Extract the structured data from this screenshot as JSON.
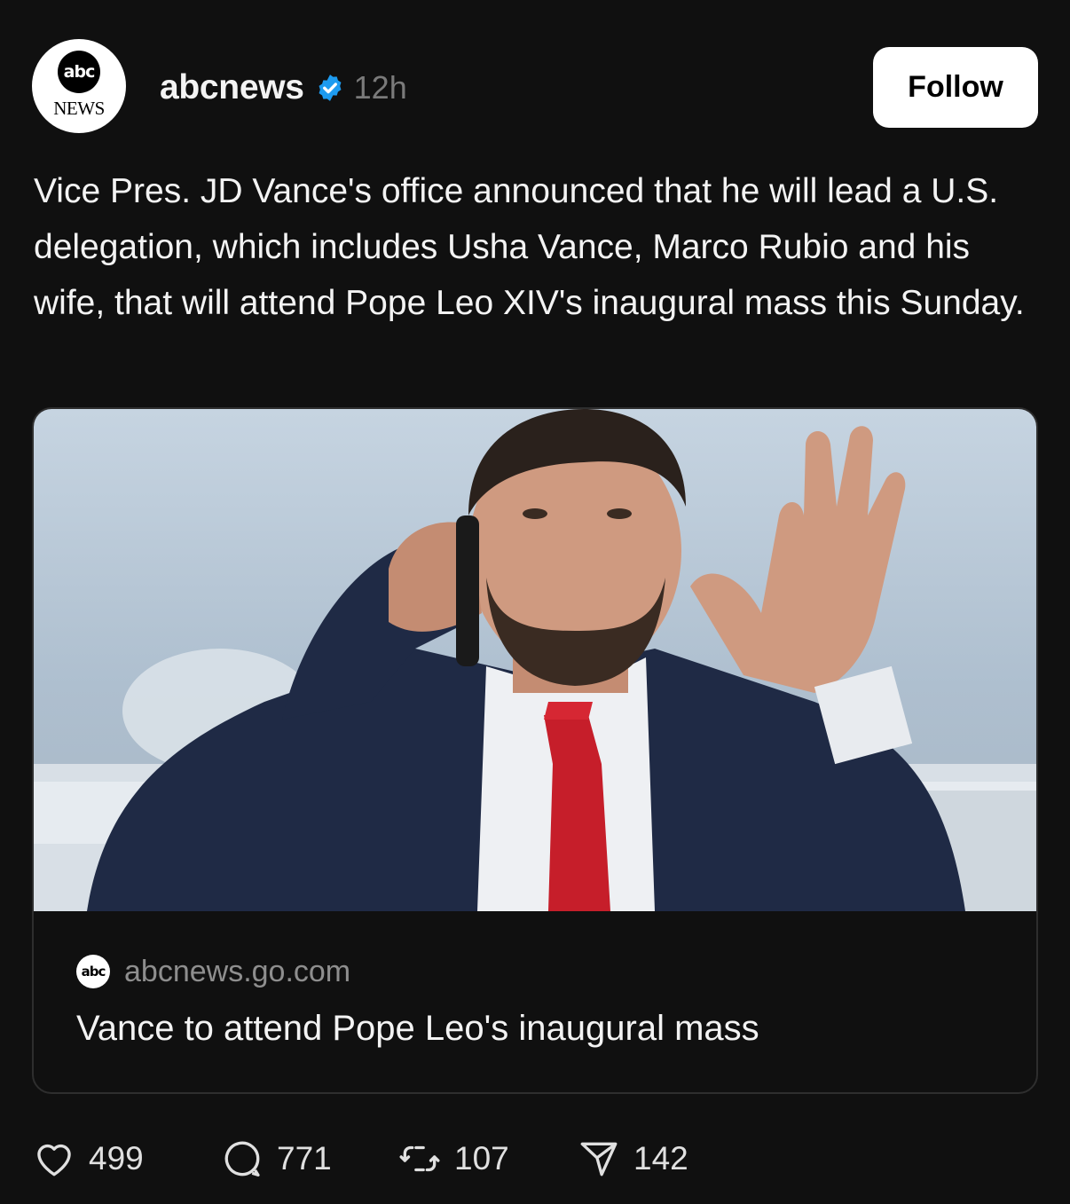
{
  "post": {
    "author": {
      "username": "abcnews",
      "verified": true,
      "timestamp": "12h",
      "avatar": {
        "logo_text": "abc",
        "wordmark": "NEWS"
      }
    },
    "follow_label": "Follow",
    "text": "Vice Pres. JD Vance's office announced that he will lead a U.S. delegation, which includes Usha Vance, Marco Rubio and his wife, that will attend Pope Leo XIV's inaugural mass this Sunday.",
    "link_card": {
      "source_icon_text": "abc",
      "domain": "abcnews.go.com",
      "title": "Vance to attend Pope Leo's inaugural mass"
    },
    "actions": {
      "likes": "499",
      "replies": "771",
      "reposts": "107",
      "shares": "142"
    }
  },
  "colors": {
    "background": "#101010",
    "text": "#f3f3f3",
    "muted": "#7a7a7a",
    "verified": "#1d9bf0",
    "follow_bg": "#ffffff"
  },
  "icons": {
    "verified": "verified-badge-icon",
    "like": "heart-icon",
    "reply": "speech-bubble-icon",
    "repost": "repost-icon",
    "share": "paper-plane-icon"
  }
}
